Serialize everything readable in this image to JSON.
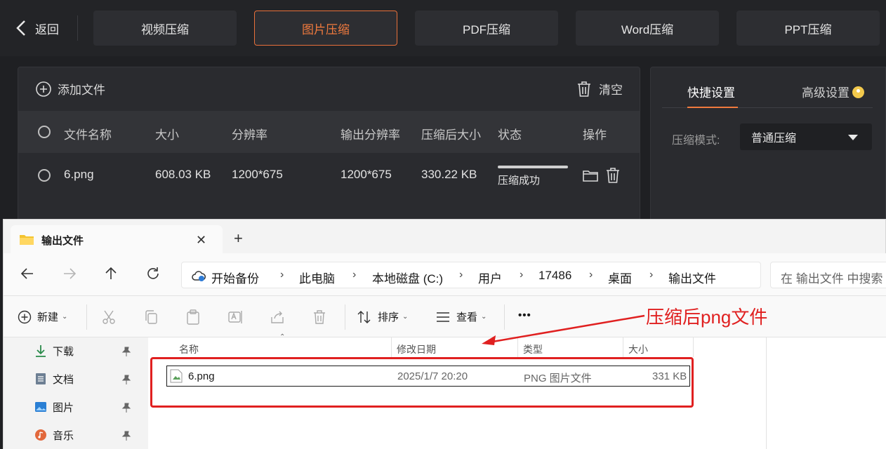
{
  "app": {
    "back_label": "返回",
    "tabs": [
      "视频压缩",
      "图片压缩",
      "PDF压缩",
      "Word压缩",
      "PPT压缩"
    ],
    "active_tab": "图片压缩",
    "accent_color": "#f07a3e",
    "add_file_label": "添加文件",
    "clear_label": "清空",
    "columns": [
      "文件名称",
      "大小",
      "分辨率",
      "输出分辨率",
      "压缩后大小",
      "状态",
      "操作"
    ],
    "row": {
      "name": "6.png",
      "size": "608.03 KB",
      "resolution": "1200*675",
      "output_resolution": "1200*675",
      "compressed_size": "330.22 KB",
      "status": "压缩成功",
      "progress": 1.0
    },
    "settings": {
      "tab_quick": "快捷设置",
      "tab_advanced": "高级设置",
      "mode_label": "压缩模式:",
      "mode_value": "普通压缩"
    }
  },
  "explorer": {
    "tab_title": "输出文件",
    "breadcrumbs": [
      "开始备份",
      "此电脑",
      "本地磁盘 (C:)",
      "用户",
      "17486",
      "桌面",
      "输出文件"
    ],
    "search_placeholder": "在 输出文件 中搜索",
    "toolbar": {
      "new_label": "新建",
      "sort_label": "排序",
      "view_label": "查看",
      "more_label": "•••"
    },
    "sidebar": [
      {
        "label": "下载",
        "icon": "download-icon"
      },
      {
        "label": "文档",
        "icon": "document-icon"
      },
      {
        "label": "图片",
        "icon": "pictures-icon"
      },
      {
        "label": "音乐",
        "icon": "music-icon"
      }
    ],
    "columns": [
      "名称",
      "修改日期",
      "类型",
      "大小"
    ],
    "file": {
      "name": "6.png",
      "modified": "2025/1/7 20:20",
      "type": "PNG 图片文件",
      "size": "331 KB"
    }
  },
  "annotation": {
    "text": "压缩后png文件",
    "color": "#e02020"
  }
}
